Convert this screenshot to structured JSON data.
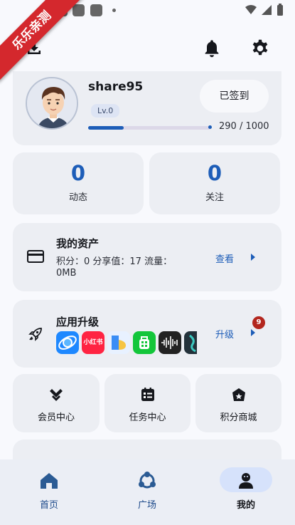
{
  "ribbon": {
    "text": "乐乐亲测"
  },
  "icons": {
    "download": "download-icon",
    "bell": "bell-icon",
    "settings": "gear-icon",
    "wallet": "card-icon",
    "rocket": "rocket-icon",
    "vip": "chevron-badge-icon",
    "tasks": "task-list-icon",
    "store": "store-icon"
  },
  "profile": {
    "username": "share95",
    "level": "Lv.0",
    "checkin_label": "已签到",
    "exp_text": "290 / 1000",
    "exp_progress": 0.29
  },
  "stats": [
    {
      "value": "0",
      "label": "动态"
    },
    {
      "value": "0",
      "label": "关注"
    }
  ],
  "assets": {
    "title": "我的资产",
    "line1": "积分：0  分享值：17  流量：",
    "line2": "0MB",
    "link": "查看"
  },
  "upgrade": {
    "title": "应用升级",
    "link": "升级",
    "badge": "9",
    "apps": [
      {
        "name": "planet-app-icon",
        "label": ""
      },
      {
        "name": "xiaohongshu-app-icon",
        "label": "小红书"
      },
      {
        "name": "blue-app-icon",
        "label": ""
      },
      {
        "name": "green-app-icon",
        "label": ""
      },
      {
        "name": "voice-app-icon",
        "label": ""
      },
      {
        "name": "dark-app-icon",
        "label": ""
      }
    ]
  },
  "quick": [
    {
      "label": "会员中心"
    },
    {
      "label": "任务中心"
    },
    {
      "label": "积分商城"
    }
  ],
  "nav": [
    {
      "label": "首页",
      "active": false
    },
    {
      "label": "广场",
      "active": false
    },
    {
      "label": "我的",
      "active": true
    }
  ],
  "colors": {
    "accent": "#1d5db8",
    "card": "#eceef3",
    "badge": "#b3261e"
  }
}
